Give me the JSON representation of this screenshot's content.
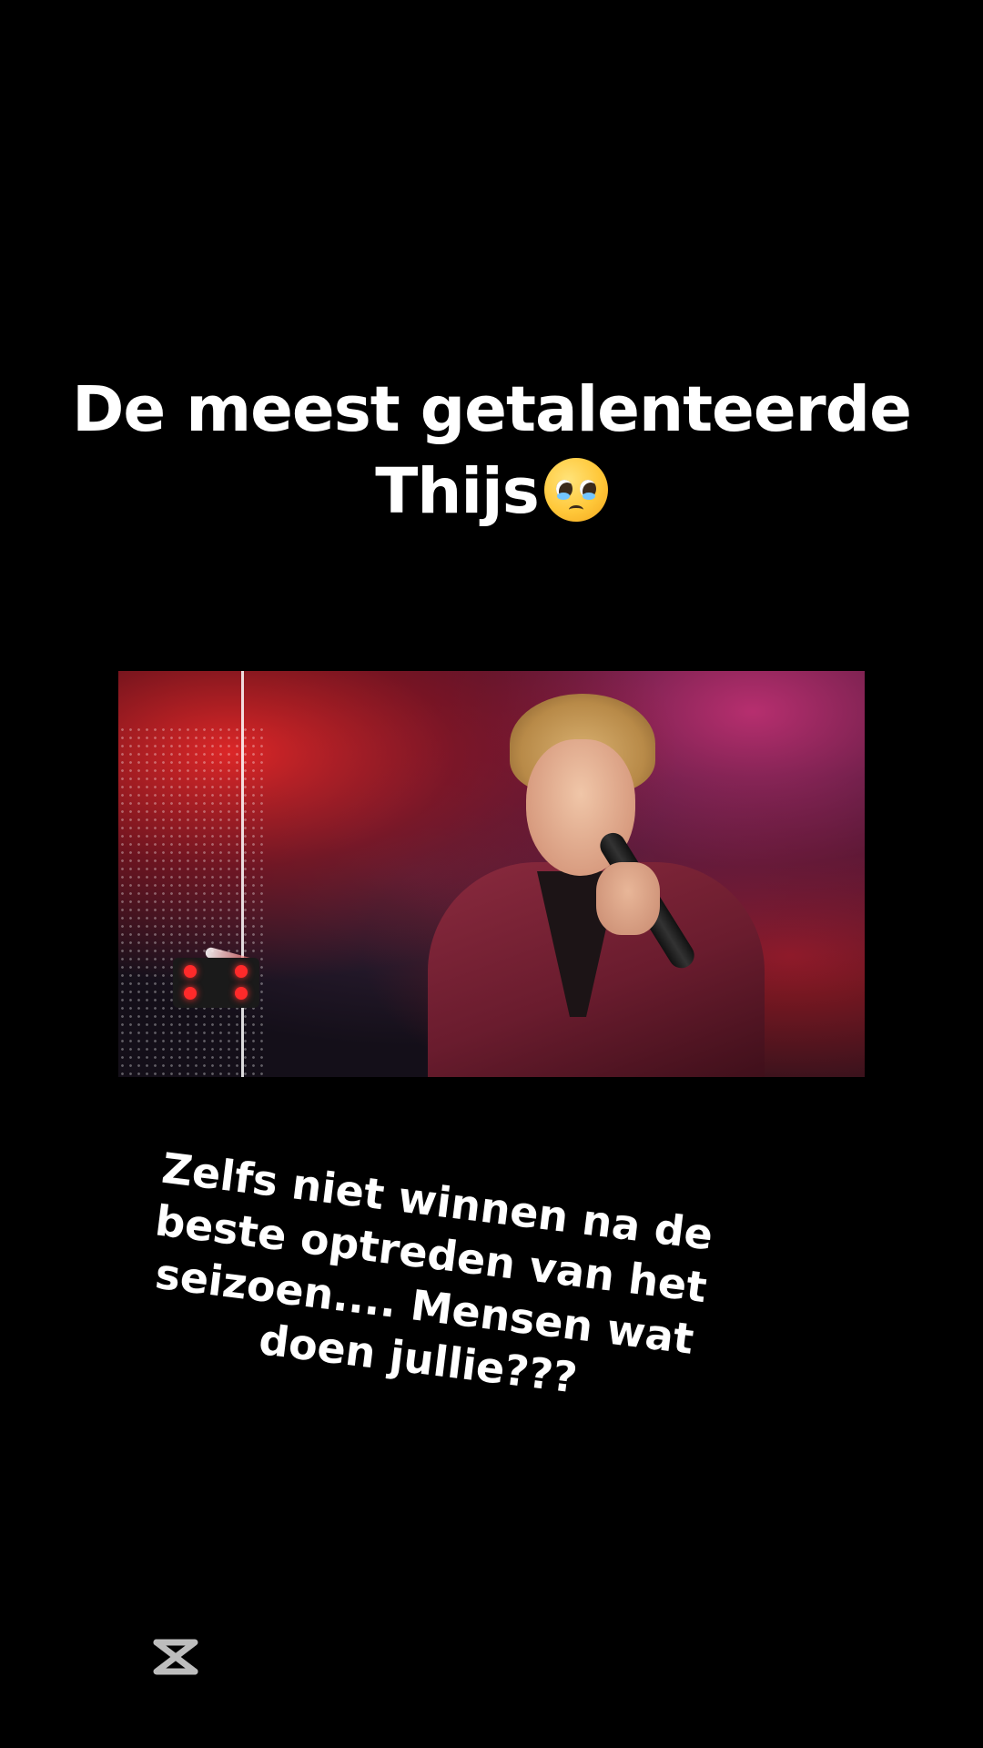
{
  "title": {
    "line1": "De meest getalenteerde",
    "line2": "Thijs",
    "emoji_icon": "pleading-face-with-tears-emoji"
  },
  "video": {
    "description_icon": "performer-singing-video-frame"
  },
  "caption": {
    "line1": "Zelfs niet winnen na de",
    "line2": "beste optreden van het",
    "line3": "seizoen.... Mensen wat",
    "line4": "doen jullie???"
  },
  "watermark": {
    "icon": "capcut-logo-icon"
  },
  "colors": {
    "background": "#000000",
    "text": "#ffffff"
  }
}
